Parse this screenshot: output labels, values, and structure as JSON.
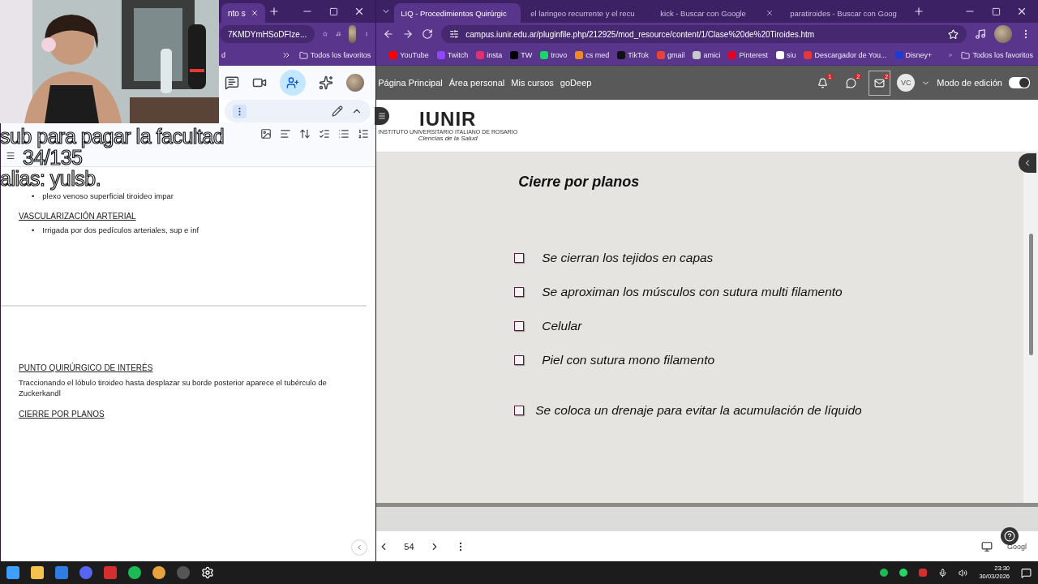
{
  "overlay": {
    "lines": [
      "sub para pagar la facultad",
      "34/135",
      "alias: yulsb."
    ]
  },
  "left_window": {
    "tabs": [
      {
        "label": "nto s",
        "selected": true
      }
    ],
    "address": "7KMDYmHSoDFIze...",
    "bookmarks": [
      "d"
    ],
    "all_bookmarks": "Todos los favoritos",
    "doc_pages": [
      [
        {
          "kind": "bullet",
          "marker": "•",
          "text": "plexo venoso superficial tiroideo impar"
        },
        {
          "kind": "heading",
          "text": "VASCULARIZACIÓN ARTERIAL"
        },
        {
          "kind": "bullet",
          "marker": "•",
          "text": "Irrigada por dos pedículos arteriales, sup e inf"
        }
      ],
      [
        {
          "kind": "heading",
          "text": "PUNTO QUIRÚRGICO DE INTERÉS"
        },
        {
          "kind": "paragraph",
          "text": "Traccionando el lóbulo tiroideo hasta desplazar su borde posterior aparece el tubérculo de Zuckerkandl"
        },
        {
          "kind": "heading",
          "text": "CIERRE POR PLANOS"
        }
      ]
    ]
  },
  "right_window": {
    "tabs": [
      {
        "label": "LIQ - Procedimientos Quirúrgic",
        "selected": true
      },
      {
        "label": "el laringeo recurrente y el recu",
        "selected": false
      },
      {
        "label": "kick - Buscar con Google",
        "selected": false
      },
      {
        "label": "paratiroides - Buscar con Goog",
        "selected": false
      }
    ],
    "url": "campus.iunir.edu.ar/pluginfile.php/212925/mod_resource/content/1/Clase%20de%20Tiroides.htm",
    "bookmarks": [
      {
        "label": "YouTube",
        "color": "#ff0000"
      },
      {
        "label": "Twitch",
        "color": "#9146ff"
      },
      {
        "label": "insta",
        "color": "#e1306c"
      },
      {
        "label": "TW",
        "color": "#000000"
      },
      {
        "label": "trovo",
        "color": "#19d66b"
      },
      {
        "label": "cs med",
        "color": "#f08a24"
      },
      {
        "label": "TikTok",
        "color": "#111111"
      },
      {
        "label": "gmail",
        "color": "#ea4335"
      },
      {
        "label": "amici",
        "color": "#c9c9c9"
      },
      {
        "label": "Pinterest",
        "color": "#e60023"
      },
      {
        "label": "siu",
        "color": "#ffffff"
      },
      {
        "label": "Descargador de You...",
        "color": "#e53935"
      },
      {
        "label": "Disney+",
        "color": "#1f3bd6"
      }
    ],
    "all_bookmarks": "Todos los favoritos",
    "nav": [
      "Página Principal",
      "Área personal",
      "Mis cursos",
      "goDeep"
    ],
    "badges": [
      "1",
      "2",
      "2"
    ],
    "avatar": "VC",
    "edit_mode": {
      "label": "Modo de edición",
      "on": true
    },
    "logo": {
      "name": "IUNIR",
      "subtitle": "INSTITUTO UNIVERSITARIO ITALIANO DE ROSARIO",
      "tagline": "Ciencias de la Salud"
    },
    "slide": {
      "title": "Cierre por planos",
      "items": [
        {
          "text": "Se cierran los tejidos en capas",
          "checked": false
        },
        {
          "text": "Se aproximan los músculos con sutura multi filamento",
          "checked": false
        },
        {
          "text": "Celular",
          "checked": false
        },
        {
          "text": "Piel con sutura mono filamento",
          "checked": false
        },
        {
          "text": "Se coloca un drenaje para evitar la acumulación de líquido",
          "checked": false
        }
      ]
    },
    "page": "54",
    "footer_label": "Googl"
  },
  "taskbar": {
    "time": "23:30",
    "date": "30/03/2026"
  }
}
